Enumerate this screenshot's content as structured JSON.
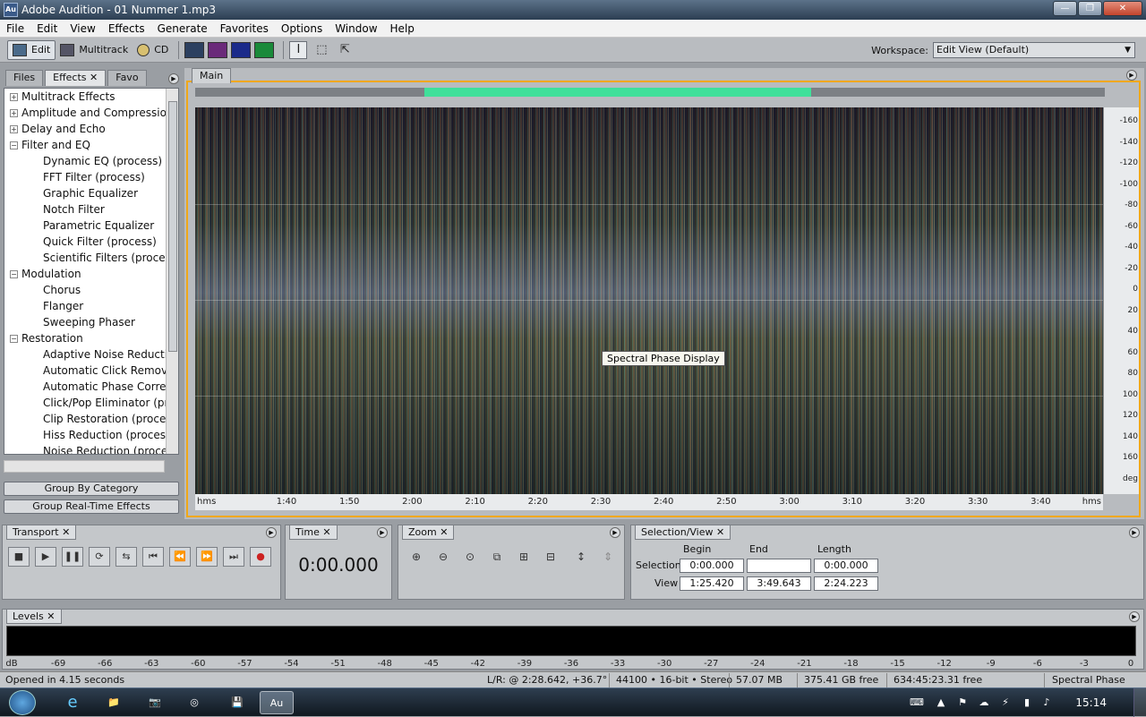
{
  "window": {
    "title": "Adobe Audition - 01 Nummer 1.mp3",
    "app_icon": "Au",
    "min": "—",
    "max": "❐",
    "close": "✕"
  },
  "menu": [
    "File",
    "Edit",
    "View",
    "Effects",
    "Generate",
    "Favorites",
    "Options",
    "Window",
    "Help"
  ],
  "toolbar": {
    "edit": "Edit",
    "multitrack": "Multitrack",
    "cd": "CD",
    "workspace_label": "Workspace:",
    "workspace_value": "Edit View (Default)"
  },
  "left_panel": {
    "tabs": [
      "Files",
      "Effects",
      "Favo"
    ],
    "tree": [
      {
        "label": "Multitrack Effects",
        "exp": "+",
        "child": false
      },
      {
        "label": "Amplitude and Compression",
        "exp": "+",
        "child": false
      },
      {
        "label": "Delay and Echo",
        "exp": "+",
        "child": false
      },
      {
        "label": "Filter and EQ",
        "exp": "−",
        "child": false
      },
      {
        "label": "Dynamic EQ (process)",
        "child": true
      },
      {
        "label": "FFT Filter (process)",
        "child": true
      },
      {
        "label": "Graphic Equalizer",
        "child": true
      },
      {
        "label": "Notch Filter",
        "child": true
      },
      {
        "label": "Parametric Equalizer",
        "child": true
      },
      {
        "label": "Quick Filter (process)",
        "child": true
      },
      {
        "label": "Scientific Filters (process)",
        "child": true
      },
      {
        "label": "Modulation",
        "exp": "−",
        "child": false
      },
      {
        "label": "Chorus",
        "child": true
      },
      {
        "label": "Flanger",
        "child": true
      },
      {
        "label": "Sweeping Phaser",
        "child": true
      },
      {
        "label": "Restoration",
        "exp": "−",
        "child": false
      },
      {
        "label": "Adaptive Noise Reduction",
        "child": true
      },
      {
        "label": "Automatic Click Remover",
        "child": true
      },
      {
        "label": "Automatic Phase Correcti",
        "child": true
      },
      {
        "label": "Click/Pop Eliminator (proc",
        "child": true
      },
      {
        "label": "Clip Restoration (process)",
        "child": true
      },
      {
        "label": "Hiss Reduction (process)",
        "child": true
      },
      {
        "label": "Noise Reduction (process)",
        "child": true
      }
    ],
    "group_by_category": "Group By Category",
    "group_realtime": "Group Real-Time Effects"
  },
  "main": {
    "tab": "Main",
    "overview_selection": {
      "start": 0.252,
      "end": 0.677
    },
    "tooltip": "Spectral Phase Display",
    "y_ticks": [
      "-160",
      "-140",
      "-120",
      "-100",
      "-80",
      "-60",
      "-40",
      "-20",
      "0",
      "20",
      "40",
      "60",
      "80",
      "100",
      "120",
      "140",
      "160",
      "deg"
    ],
    "x_ticks": [
      "1:40",
      "1:50",
      "2:00",
      "2:10",
      "2:20",
      "2:30",
      "2:40",
      "2:50",
      "3:00",
      "3:10",
      "3:20",
      "3:30",
      "3:40"
    ],
    "x_unit": "hms"
  },
  "transport": {
    "tab": "Transport",
    "buttons": [
      "■",
      "▶",
      "❚❚",
      "⟳",
      "⇆",
      "⏮",
      "⏪",
      "⏩",
      "⏭",
      "●"
    ]
  },
  "time": {
    "tab": "Time",
    "value": "0:00.000"
  },
  "zoom": {
    "tab": "Zoom",
    "buttons": [
      "⊕",
      "⊖",
      "⊙",
      "⧉",
      "⊞",
      "⊟",
      "↕",
      "⇕"
    ]
  },
  "selection_view": {
    "tab": "Selection/View",
    "headers": {
      "begin": "Begin",
      "end": "End",
      "length": "Length"
    },
    "selection_label": "Selection",
    "view_label": "View",
    "selection": {
      "begin": "0:00.000",
      "end": "",
      "length": "0:00.000"
    },
    "view": {
      "begin": "1:25.420",
      "end": "3:49.643",
      "length": "2:24.223"
    }
  },
  "levels": {
    "tab": "Levels",
    "ticks": [
      "dB",
      "-69",
      "-66",
      "-63",
      "-60",
      "-57",
      "-54",
      "-51",
      "-48",
      "-45",
      "-42",
      "-39",
      "-36",
      "-33",
      "-30",
      "-27",
      "-24",
      "-21",
      "-18",
      "-15",
      "-12",
      "-9",
      "-6",
      "-3",
      "0"
    ]
  },
  "status": {
    "message": "Opened in 4.15 seconds",
    "cursor": "L/R: @   2:28.642, +36.7°",
    "format": "44100 • 16-bit • Stereo",
    "size": "57.07 MB",
    "disk": "375.41 GB free",
    "time_free": "634:45:23.31 free",
    "display": "Spectral Phase"
  },
  "taskbar": {
    "clock": "15:14",
    "au": "Au"
  }
}
